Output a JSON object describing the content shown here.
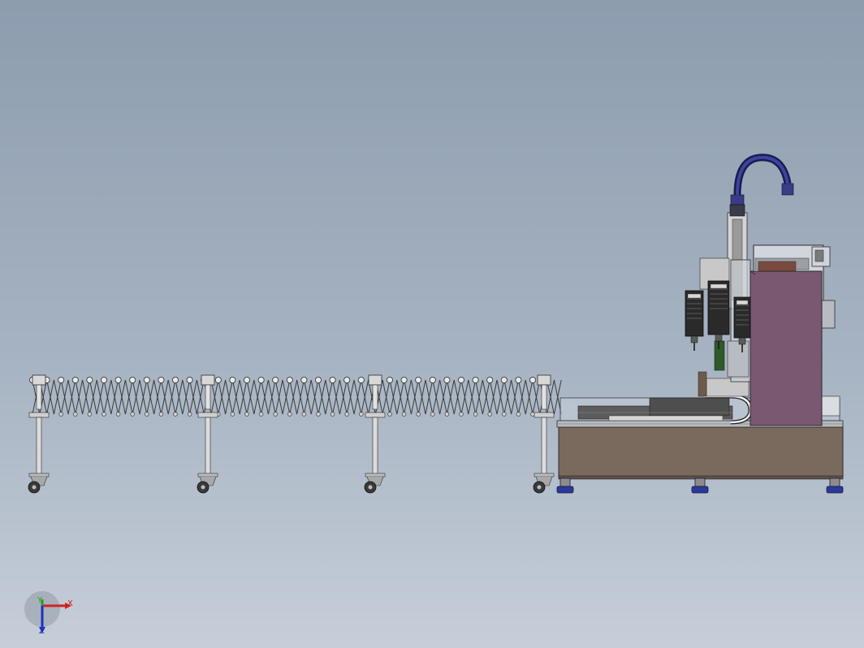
{
  "viewport": {
    "background_top": "#8d9cae",
    "background_bottom": "#c6ced9"
  },
  "model": {
    "conveyor": {
      "component": "flexible-roller-conveyor",
      "leg_count": 4,
      "caster_count": 4
    },
    "machine": {
      "component": "gantry-screwdriving-station",
      "screwdriver_count": 3,
      "body_color": "#7a6a5e",
      "cabinet_color": "#7a5872",
      "hose_color": "#26286e",
      "foot_color": "#2a3a9a"
    }
  },
  "triad": {
    "x_label": "X",
    "y_label": "Y",
    "z_label": "Z",
    "x_color": "#d62020",
    "y_color": "#20a020",
    "z_color": "#2030c0"
  }
}
